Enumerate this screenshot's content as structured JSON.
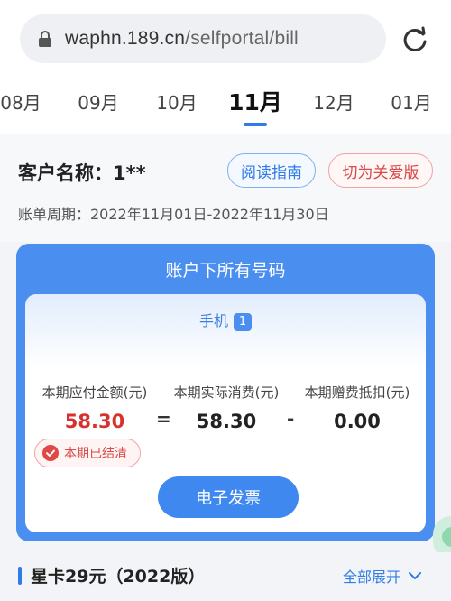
{
  "browser": {
    "url_host": "waphn.189.cn",
    "url_path": "/selfportal/bill"
  },
  "months": {
    "tabs": [
      "08月",
      "09月",
      "10月",
      "11月",
      "12月",
      "01月"
    ],
    "active": "11月"
  },
  "customer": {
    "name_label": "客户名称：1**",
    "guide_button": "阅读指南",
    "care_button": "切为关爱版",
    "period": "账单周期：2022年11月01日-2022年11月30日"
  },
  "account_card": {
    "header": "账户下所有号码",
    "phone_label": "手机",
    "phone_count": "1",
    "due_label": "本期应付金额(元)",
    "due_value": "58.30",
    "eq_sign": "=",
    "actual_label": "本期实际消费(元)",
    "actual_value": "58.30",
    "minus_sign": "-",
    "gift_label": "本期赠费抵扣(元)",
    "gift_value": "0.00",
    "settled_badge": "本期已结清",
    "invoice_button": "电子发票"
  },
  "plan": {
    "title": "星卡29元（2022版）",
    "expand_link": "全部展开"
  },
  "colors": {
    "accent": "#2f7be8",
    "card_blue": "#4a8ff0",
    "due_red": "#d8302c",
    "care_red": "#d94a4a"
  }
}
